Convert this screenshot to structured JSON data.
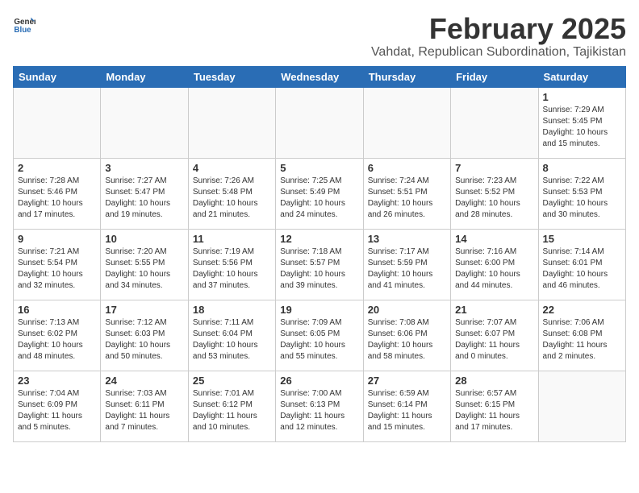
{
  "logo": {
    "general": "General",
    "blue": "Blue"
  },
  "title": "February 2025",
  "location": "Vahdat, Republican Subordination, Tajikistan",
  "weekdays": [
    "Sunday",
    "Monday",
    "Tuesday",
    "Wednesday",
    "Thursday",
    "Friday",
    "Saturday"
  ],
  "weeks": [
    [
      {
        "day": "",
        "info": ""
      },
      {
        "day": "",
        "info": ""
      },
      {
        "day": "",
        "info": ""
      },
      {
        "day": "",
        "info": ""
      },
      {
        "day": "",
        "info": ""
      },
      {
        "day": "",
        "info": ""
      },
      {
        "day": "1",
        "info": "Sunrise: 7:29 AM\nSunset: 5:45 PM\nDaylight: 10 hours and 15 minutes."
      }
    ],
    [
      {
        "day": "2",
        "info": "Sunrise: 7:28 AM\nSunset: 5:46 PM\nDaylight: 10 hours and 17 minutes."
      },
      {
        "day": "3",
        "info": "Sunrise: 7:27 AM\nSunset: 5:47 PM\nDaylight: 10 hours and 19 minutes."
      },
      {
        "day": "4",
        "info": "Sunrise: 7:26 AM\nSunset: 5:48 PM\nDaylight: 10 hours and 21 minutes."
      },
      {
        "day": "5",
        "info": "Sunrise: 7:25 AM\nSunset: 5:49 PM\nDaylight: 10 hours and 24 minutes."
      },
      {
        "day": "6",
        "info": "Sunrise: 7:24 AM\nSunset: 5:51 PM\nDaylight: 10 hours and 26 minutes."
      },
      {
        "day": "7",
        "info": "Sunrise: 7:23 AM\nSunset: 5:52 PM\nDaylight: 10 hours and 28 minutes."
      },
      {
        "day": "8",
        "info": "Sunrise: 7:22 AM\nSunset: 5:53 PM\nDaylight: 10 hours and 30 minutes."
      }
    ],
    [
      {
        "day": "9",
        "info": "Sunrise: 7:21 AM\nSunset: 5:54 PM\nDaylight: 10 hours and 32 minutes."
      },
      {
        "day": "10",
        "info": "Sunrise: 7:20 AM\nSunset: 5:55 PM\nDaylight: 10 hours and 34 minutes."
      },
      {
        "day": "11",
        "info": "Sunrise: 7:19 AM\nSunset: 5:56 PM\nDaylight: 10 hours and 37 minutes."
      },
      {
        "day": "12",
        "info": "Sunrise: 7:18 AM\nSunset: 5:57 PM\nDaylight: 10 hours and 39 minutes."
      },
      {
        "day": "13",
        "info": "Sunrise: 7:17 AM\nSunset: 5:59 PM\nDaylight: 10 hours and 41 minutes."
      },
      {
        "day": "14",
        "info": "Sunrise: 7:16 AM\nSunset: 6:00 PM\nDaylight: 10 hours and 44 minutes."
      },
      {
        "day": "15",
        "info": "Sunrise: 7:14 AM\nSunset: 6:01 PM\nDaylight: 10 hours and 46 minutes."
      }
    ],
    [
      {
        "day": "16",
        "info": "Sunrise: 7:13 AM\nSunset: 6:02 PM\nDaylight: 10 hours and 48 minutes."
      },
      {
        "day": "17",
        "info": "Sunrise: 7:12 AM\nSunset: 6:03 PM\nDaylight: 10 hours and 50 minutes."
      },
      {
        "day": "18",
        "info": "Sunrise: 7:11 AM\nSunset: 6:04 PM\nDaylight: 10 hours and 53 minutes."
      },
      {
        "day": "19",
        "info": "Sunrise: 7:09 AM\nSunset: 6:05 PM\nDaylight: 10 hours and 55 minutes."
      },
      {
        "day": "20",
        "info": "Sunrise: 7:08 AM\nSunset: 6:06 PM\nDaylight: 10 hours and 58 minutes."
      },
      {
        "day": "21",
        "info": "Sunrise: 7:07 AM\nSunset: 6:07 PM\nDaylight: 11 hours and 0 minutes."
      },
      {
        "day": "22",
        "info": "Sunrise: 7:06 AM\nSunset: 6:08 PM\nDaylight: 11 hours and 2 minutes."
      }
    ],
    [
      {
        "day": "23",
        "info": "Sunrise: 7:04 AM\nSunset: 6:09 PM\nDaylight: 11 hours and 5 minutes."
      },
      {
        "day": "24",
        "info": "Sunrise: 7:03 AM\nSunset: 6:11 PM\nDaylight: 11 hours and 7 minutes."
      },
      {
        "day": "25",
        "info": "Sunrise: 7:01 AM\nSunset: 6:12 PM\nDaylight: 11 hours and 10 minutes."
      },
      {
        "day": "26",
        "info": "Sunrise: 7:00 AM\nSunset: 6:13 PM\nDaylight: 11 hours and 12 minutes."
      },
      {
        "day": "27",
        "info": "Sunrise: 6:59 AM\nSunset: 6:14 PM\nDaylight: 11 hours and 15 minutes."
      },
      {
        "day": "28",
        "info": "Sunrise: 6:57 AM\nSunset: 6:15 PM\nDaylight: 11 hours and 17 minutes."
      },
      {
        "day": "",
        "info": ""
      }
    ]
  ]
}
